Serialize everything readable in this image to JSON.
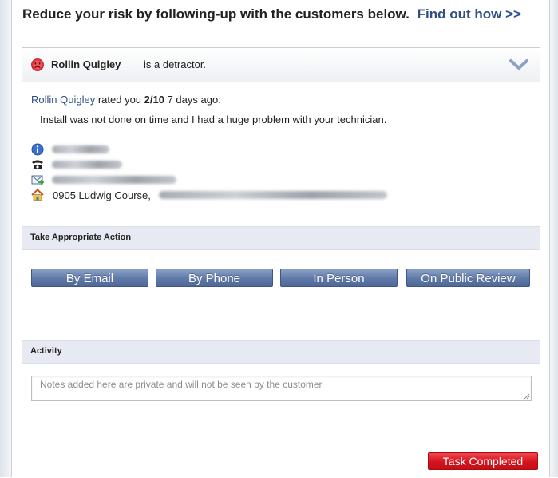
{
  "headline": {
    "text": "Reduce your risk by following-up with the customers below.",
    "link": "Find out how >>"
  },
  "customer": {
    "name": "Rollin Quigley",
    "status_suffix": "is a detractor.",
    "rated_prefix": "rated you",
    "score": "2/10",
    "when": "7 days ago:",
    "comment": "Install was not done on time and I had a huge problem with your technician.",
    "address_visible": "0905 Ludwig Course,"
  },
  "icons": {
    "status": "sad-face-icon",
    "expand": "chevron-down-icon",
    "info": "info-icon",
    "phone": "phone-icon",
    "email": "email-icon",
    "address": "home-icon"
  },
  "sections": {
    "action_title": "Take Appropriate Action",
    "activity_title": "Activity"
  },
  "actions": {
    "email": "By Email",
    "phone": "By Phone",
    "in_person": "In Person",
    "public_review": "On Public Review"
  },
  "activity": {
    "notes_placeholder": "Notes added here are private and will not be seen by the customer."
  },
  "task_button": "Task Completed",
  "colors": {
    "link": "#2f4f86",
    "action_button": "#5f79a8",
    "task_button": "#d5131c",
    "section_bar": "#e7eaf3"
  }
}
